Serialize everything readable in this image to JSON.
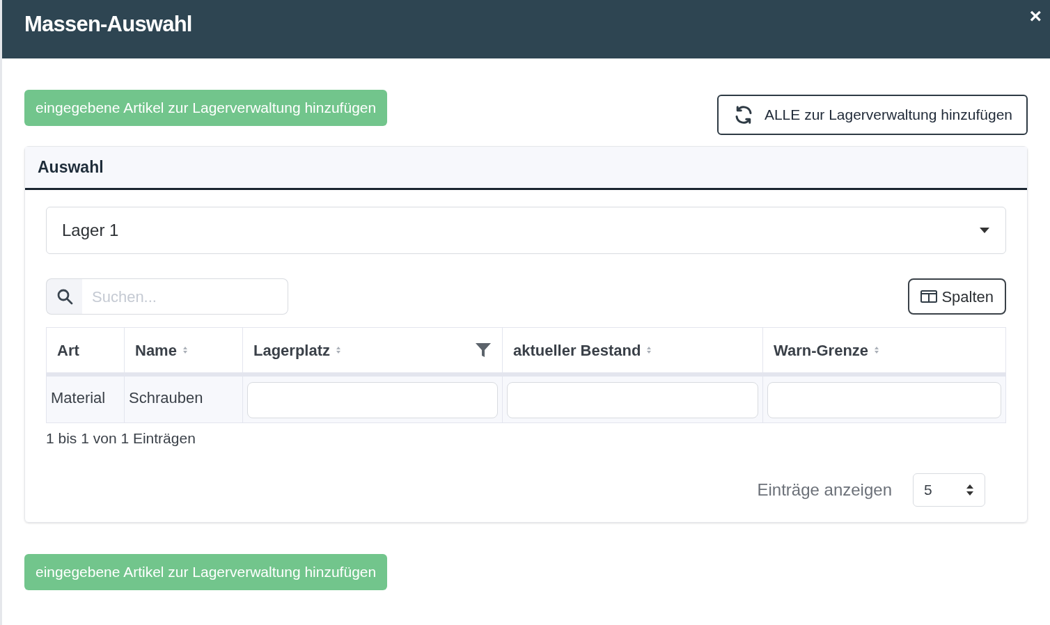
{
  "window": {
    "title": "Massen-Auswahl",
    "close": "×"
  },
  "top_actions": {
    "primary": "eingegebene Artikel zur Lagerverwaltung hinzufügen",
    "secondary": "ALLE zur Lagerverwaltung hinzufügen"
  },
  "panel": {
    "title": "Auswahl",
    "select_value": "Lager 1"
  },
  "search": {
    "placeholder": "Suchen..."
  },
  "columns_button": "Spalten",
  "table": {
    "columns": [
      {
        "label": "Art",
        "sortable": false,
        "filter": false
      },
      {
        "label": "Name",
        "sortable": true,
        "filter": false
      },
      {
        "label": "Lagerplatz",
        "sortable": true,
        "filter": true
      },
      {
        "label": "aktueller Bestand",
        "sortable": true,
        "filter": false
      },
      {
        "label": "Warn-Grenze",
        "sortable": true,
        "filter": false
      }
    ],
    "rows": [
      [
        {
          "kind": "text",
          "value": "Material"
        },
        {
          "kind": "text",
          "value": "Schrauben"
        },
        {
          "kind": "input"
        },
        {
          "kind": "input"
        },
        {
          "kind": "input"
        }
      ]
    ]
  },
  "summary": "1 bis 1 von 1 Einträgen",
  "page_size": {
    "label": "Einträge anzeigen",
    "value": "5"
  },
  "bottom_action": "eingegebene Artikel zur Lagerverwaltung hinzufügen"
}
